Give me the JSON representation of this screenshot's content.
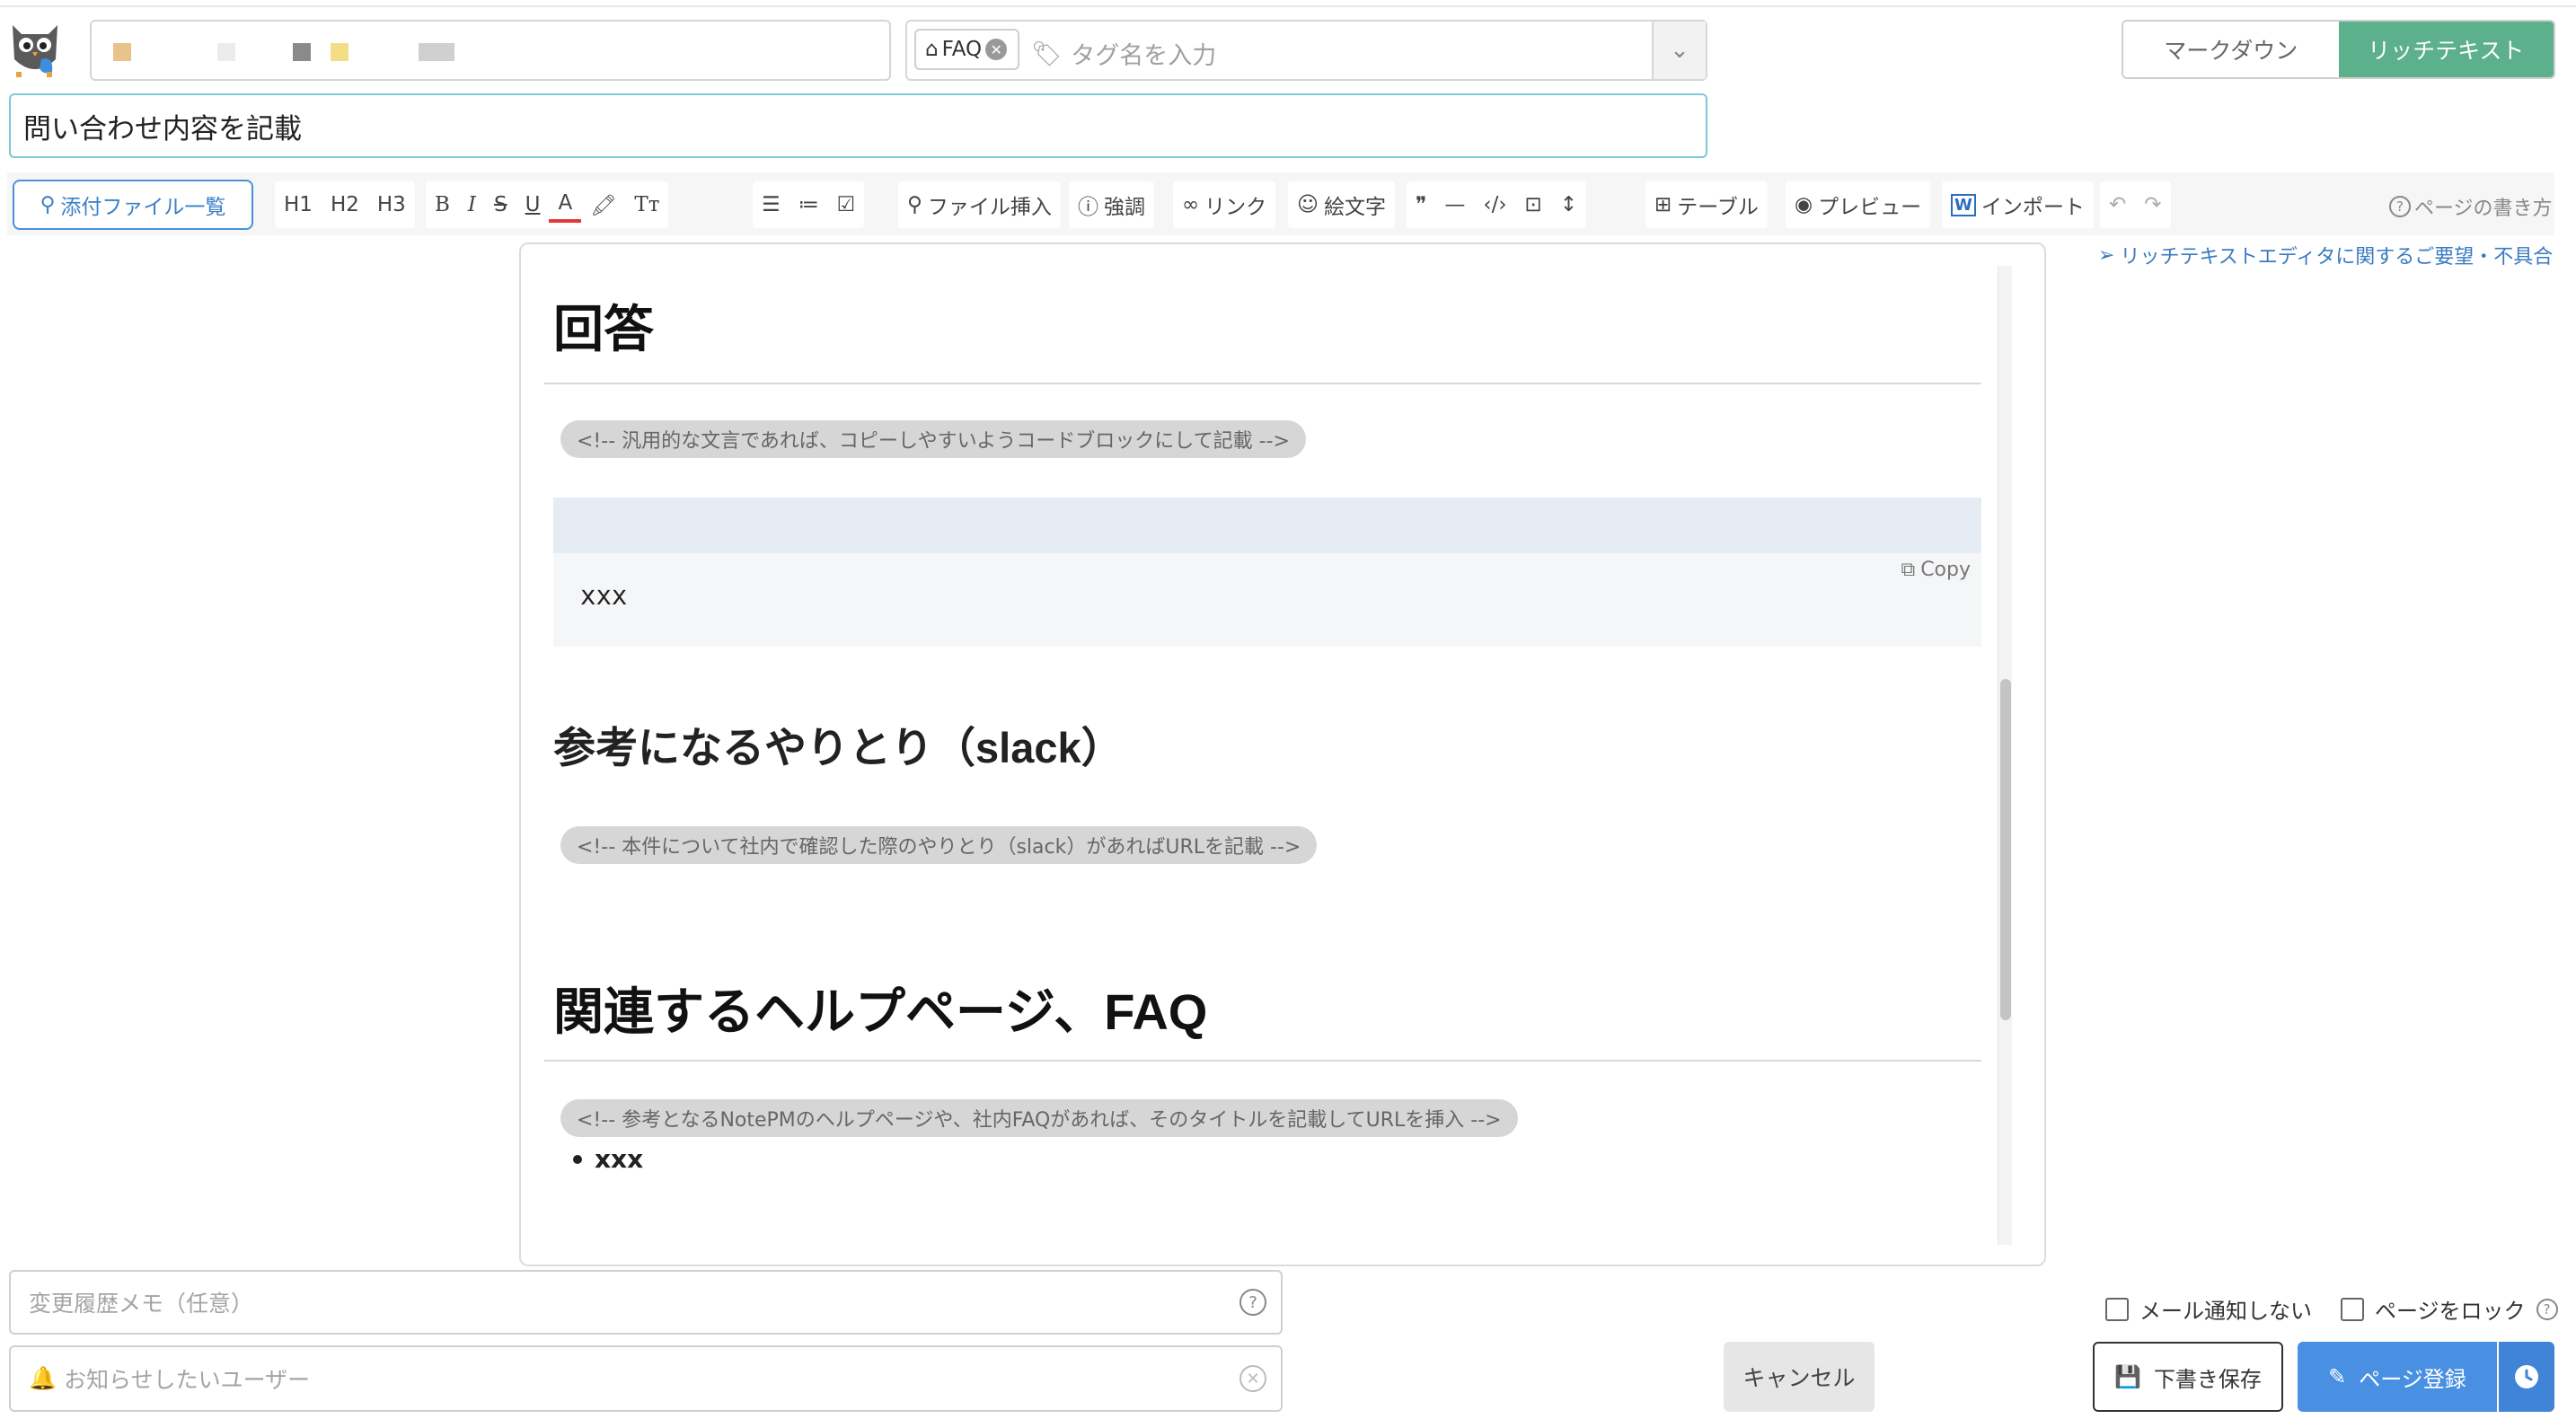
{
  "header": {
    "tag_chip": "FAQ",
    "tag_placeholder": "タグ名を入力",
    "mode_markdown": "マークダウン",
    "mode_richtext": "リッチテキスト",
    "path_block_colors": [
      "#e9c48a",
      "#ececec",
      "#8a8a8a",
      "#f5dd86",
      "#d0d0d0"
    ]
  },
  "title": {
    "value": "問い合わせ内容を記載"
  },
  "toolbar": {
    "attach_label": "添付ファイル一覧",
    "h1": "H1",
    "h2": "H2",
    "h3": "H3",
    "bold": "B",
    "italic": "I",
    "strike": "S",
    "underline": "U",
    "font_color": "A",
    "text_size": "Tт",
    "file_insert": "ファイル挿入",
    "emphasis": "強調",
    "link": "リンク",
    "emoji": "絵文字",
    "quote": "❞",
    "hr": "—",
    "table": "テーブル",
    "preview": "プレビュー",
    "import": "インポート",
    "howto": "ページの書き方",
    "feedback": "リッチテキストエディタに関するご要望・不具合"
  },
  "editor": {
    "h_answer": "回答",
    "comment_1": "<!-- 汎用的な文言であれば、コピーしやすいようコードブロックにして記載 -->",
    "code_text": "xxx",
    "copy_label": "Copy",
    "h_reference": "参考になるやりとり（slack）",
    "comment_2": "<!-- 本件について社内で確認した際のやりとり（slack）があればURLを記載 -->",
    "h_related": "関連するヘルプページ、FAQ",
    "comment_3": "<!-- 参考となるNotePMのヘルプページや、社内FAQがあれば、そのタイトルを記載してURLを挿入 -->",
    "bullet_1": "xxx"
  },
  "footer": {
    "memo_placeholder": "変更履歴メモ（任意）",
    "notify_placeholder": "お知らせしたいユーザー",
    "no_mail_label": "メール通知しない",
    "lock_label": "ページをロック",
    "cancel_label": "キャンセル",
    "draft_label": "下書き保存",
    "submit_label": "ページ登録"
  },
  "colors": {
    "accent_green": "#5cb08c",
    "primary_blue": "#4a90e2",
    "link_blue": "#3a7bc0"
  }
}
